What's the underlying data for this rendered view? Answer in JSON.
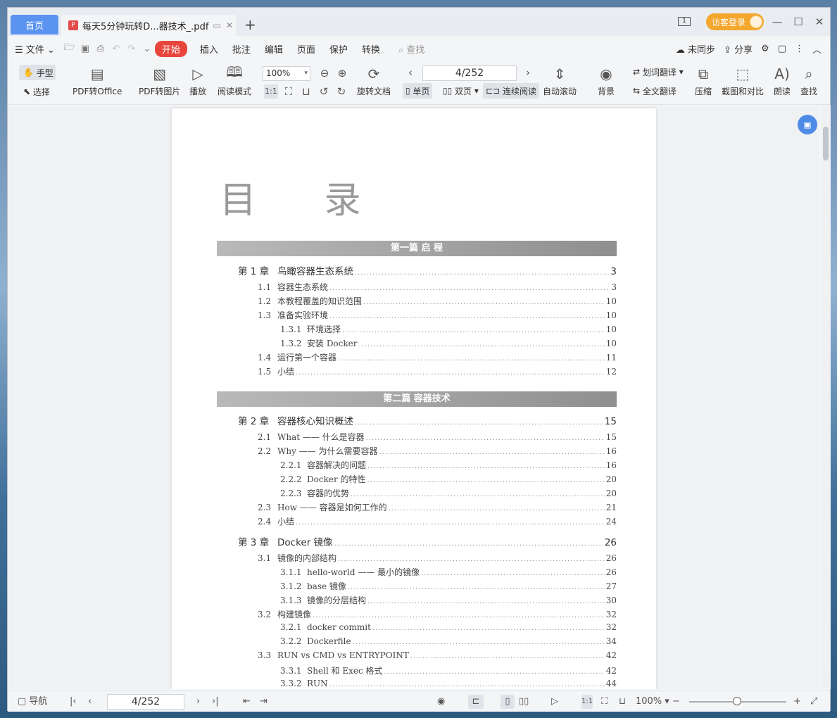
{
  "titlebar": {
    "home_tab": "首页",
    "doc_tab": "每天5分钟玩转D...器技术_.pdf",
    "add_tab": "+",
    "login": "访客登录"
  },
  "menubar": {
    "file": "文件",
    "items": [
      "开始",
      "插入",
      "批注",
      "编辑",
      "页面",
      "保护",
      "转换"
    ],
    "search": "查找",
    "sync": "未同步",
    "share": "分享"
  },
  "toolbar": {
    "hand": "手型",
    "select": "选择",
    "pdf_to_office": "PDF转Office",
    "pdf_to_image": "PDF转图片",
    "play": "播放",
    "read_mode": "阅读模式",
    "zoom": "100%",
    "rotate": "旋转文档",
    "page": "4/252",
    "single": "单页",
    "double": "双页",
    "continuous": "连续阅读",
    "auto_scroll": "自动滚动",
    "background": "背景",
    "word_translate": "划词翻译",
    "full_translate": "全文翻译",
    "compress": "压缩",
    "screenshot_compare": "截图和对比",
    "read_aloud": "朗读",
    "find": "查找"
  },
  "document": {
    "toc_title": "目 录",
    "part1": "第一篇 启 程",
    "part2": "第二篇 容器技术",
    "entries": [
      {
        "type": "chap",
        "num": "第 1 章",
        "text": "鸟瞰容器生态系统",
        "page": "3"
      },
      {
        "type": "sec",
        "num": "1.1",
        "text": "容器生态系统",
        "page": "3"
      },
      {
        "type": "sec",
        "num": "1.2",
        "text": "本教程覆盖的知识范围",
        "page": "10"
      },
      {
        "type": "sec",
        "num": "1.3",
        "text": "准备实验环境",
        "page": "10"
      },
      {
        "type": "sub",
        "num": "1.3.1",
        "text": "环境选择",
        "page": "10"
      },
      {
        "type": "sub",
        "num": "1.3.2",
        "text": "安装 Docker",
        "page": "10"
      },
      {
        "type": "sec",
        "num": "1.4",
        "text": "运行第一个容器",
        "page": "11"
      },
      {
        "type": "sec",
        "num": "1.5",
        "text": "小结",
        "page": "12"
      },
      {
        "type": "chap",
        "num": "第 2 章",
        "text": "容器核心知识概述",
        "page": "15"
      },
      {
        "type": "sec",
        "num": "2.1",
        "text": "What —— 什么是容器",
        "page": "15"
      },
      {
        "type": "sec",
        "num": "2.2",
        "text": "Why —— 为什么需要容器",
        "page": "16"
      },
      {
        "type": "sub",
        "num": "2.2.1",
        "text": "容器解决的问题",
        "page": "16"
      },
      {
        "type": "sub",
        "num": "2.2.2",
        "text": "Docker 的特性",
        "page": "20"
      },
      {
        "type": "sub",
        "num": "2.2.3",
        "text": "容器的优势",
        "page": "20"
      },
      {
        "type": "sec",
        "num": "2.3",
        "text": "How —— 容器是如何工作的",
        "page": "21"
      },
      {
        "type": "sec",
        "num": "2.4",
        "text": "小结",
        "page": "24"
      },
      {
        "type": "chap",
        "num": "第 3 章",
        "text": "Docker 镜像",
        "page": "26"
      },
      {
        "type": "sec",
        "num": "3.1",
        "text": "镜像的内部结构",
        "page": "26"
      },
      {
        "type": "sub",
        "num": "3.1.1",
        "text": "hello-world —— 最小的镜像",
        "page": "26"
      },
      {
        "type": "sub",
        "num": "3.1.2",
        "text": "base 镜像",
        "page": "27"
      },
      {
        "type": "sub",
        "num": "3.1.3",
        "text": "镜像的分层结构",
        "page": "30"
      },
      {
        "type": "sec",
        "num": "3.2",
        "text": "构建镜像",
        "page": "32"
      },
      {
        "type": "sub",
        "num": "3.2.1",
        "text": "docker commit",
        "page": "32"
      },
      {
        "type": "sub",
        "num": "3.2.2",
        "text": "Dockerfile",
        "page": "34"
      },
      {
        "type": "sec",
        "num": "3.3",
        "text": "RUN vs CMD vs ENTRYPOINT",
        "page": "42"
      },
      {
        "type": "sub",
        "num": "3.3.1",
        "text": "Shell 和 Exec 格式",
        "page": "42"
      },
      {
        "type": "sub",
        "num": "3.3.2",
        "text": "RUN",
        "page": "44"
      }
    ]
  },
  "statusbar": {
    "nav": "导航",
    "page": "4/252",
    "zoom": "100%"
  }
}
